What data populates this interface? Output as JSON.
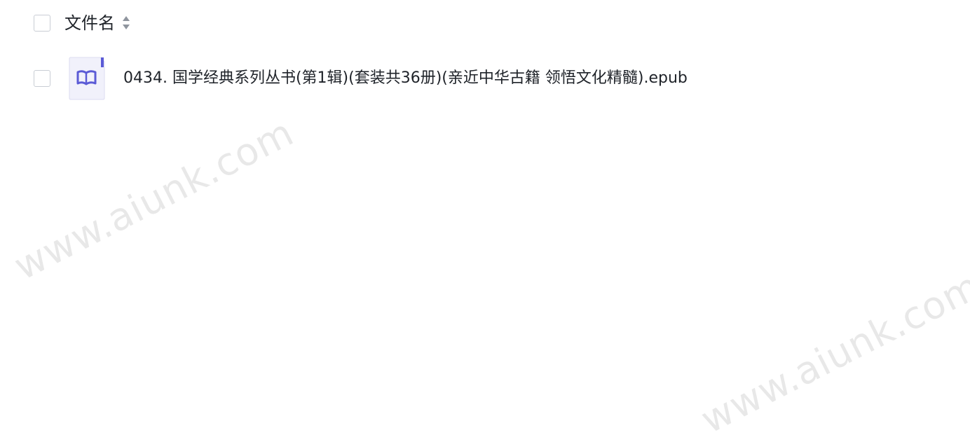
{
  "file_list": {
    "header": {
      "column_name": "文件名"
    },
    "rows": [
      {
        "file_name": "0434. 国学经典系列丛书(第1辑)(套装共36册)(亲近中华古籍 领悟文化精髓).epub",
        "file_type": "ebook",
        "icon": "ebook-file-icon"
      }
    ]
  },
  "watermark": {
    "text": "www.aiunk.com"
  },
  "colors": {
    "text": "#1f2329",
    "checkbox_border": "#c9cdd4",
    "icon_accent": "#5b5bd6",
    "icon_bg": "#f1f1fb"
  }
}
